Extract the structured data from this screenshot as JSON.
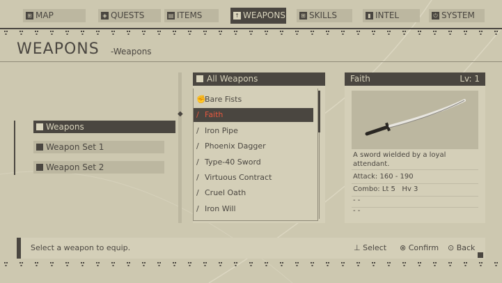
{
  "nav": {
    "tabs": [
      {
        "label": "MAP",
        "icon": "map-icon",
        "glyph": "⊞"
      },
      {
        "label": "QUESTS",
        "icon": "quests-icon",
        "glyph": "◈"
      },
      {
        "label": "ITEMS",
        "icon": "items-icon",
        "glyph": "▤"
      },
      {
        "label": "WEAPONS",
        "icon": "weapons-icon",
        "glyph": "↑"
      },
      {
        "label": "SKILLS",
        "icon": "skills-icon",
        "glyph": "⊞"
      },
      {
        "label": "INTEL",
        "icon": "intel-icon",
        "glyph": "▮"
      },
      {
        "label": "SYSTEM",
        "icon": "system-icon",
        "glyph": "⏻"
      }
    ],
    "active": "WEAPONS"
  },
  "header": {
    "title": "WEAPONS",
    "subtitle": "-Weapons"
  },
  "left_menu": {
    "items": [
      {
        "label": "Weapons"
      },
      {
        "label": "Weapon Set 1"
      },
      {
        "label": "Weapon Set 2"
      }
    ]
  },
  "weapon_list": {
    "header": "All Weapons",
    "items": [
      {
        "label": "Bare Fists",
        "icon": "fist-icon",
        "glyph": "✊"
      },
      {
        "label": "Faith",
        "icon": "sword-icon",
        "glyph": "/"
      },
      {
        "label": "Iron Pipe",
        "icon": "sword-icon",
        "glyph": "/"
      },
      {
        "label": "Phoenix Dagger",
        "icon": "sword-icon",
        "glyph": "/"
      },
      {
        "label": "Type-40 Sword",
        "icon": "sword-icon",
        "glyph": "/"
      },
      {
        "label": "Virtuous Contract",
        "icon": "sword-icon",
        "glyph": "/"
      },
      {
        "label": "Cruel Oath",
        "icon": "sword-icon",
        "glyph": "/"
      },
      {
        "label": "Iron Will",
        "icon": "heavy-sword-icon",
        "glyph": "/"
      }
    ]
  },
  "detail": {
    "name": "Faith",
    "level": "Lv: 1",
    "description": "A sword wielded by a loyal attendant.",
    "attack": "Attack: 160 - 190",
    "combo": "Combo: Lt 5   Hv 3",
    "slot1": "- -",
    "slot2": "- -"
  },
  "bottom": {
    "message": "Select a weapon to equip.",
    "select": "Select",
    "confirm": "Confirm",
    "back": "Back"
  },
  "colors": {
    "dark": "#4a4640",
    "background": "#cdc8b0",
    "panel": "#d4cfb8",
    "selected_text": "#e8583e"
  }
}
